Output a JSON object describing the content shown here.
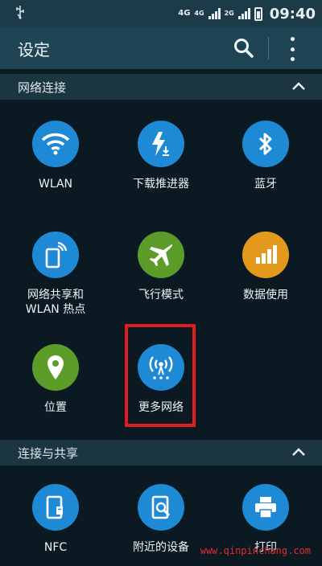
{
  "statusbar": {
    "net_a": "4G",
    "net_b": "4G",
    "net_c": "2G",
    "time": "09:40"
  },
  "appbar": {
    "title": "设定"
  },
  "sections": [
    {
      "title": "网络连接",
      "tiles": [
        {
          "label": "WLAN",
          "color": "#1e8ad6",
          "icon": "wifi-icon"
        },
        {
          "label": "下载推进器",
          "color": "#1e8ad6",
          "icon": "download-booster-icon"
        },
        {
          "label": "蓝牙",
          "color": "#1e8ad6",
          "icon": "bluetooth-icon"
        },
        {
          "label": "网络共享和\nWLAN 热点",
          "color": "#1e8ad6",
          "icon": "tethering-hotspot-icon"
        },
        {
          "label": "飞行模式",
          "color": "#5c9d2a",
          "icon": "airplane-icon"
        },
        {
          "label": "数据使用",
          "color": "#e39a1c",
          "icon": "data-usage-icon"
        },
        {
          "label": "位置",
          "color": "#5c9d2a",
          "icon": "location-pin-icon"
        },
        {
          "label": "更多网络",
          "color": "#1e8ad6",
          "icon": "antenna-icon"
        }
      ]
    },
    {
      "title": "连接与共享",
      "tiles": [
        {
          "label": "NFC",
          "color": "#1e8ad6",
          "icon": "nfc-icon"
        },
        {
          "label": "附近的设备",
          "color": "#1e8ad6",
          "icon": "nearby-devices-icon"
        },
        {
          "label": "打印",
          "color": "#1e8ad6",
          "icon": "printer-icon"
        }
      ]
    }
  ],
  "watermark": "www.qinpinchang.com"
}
